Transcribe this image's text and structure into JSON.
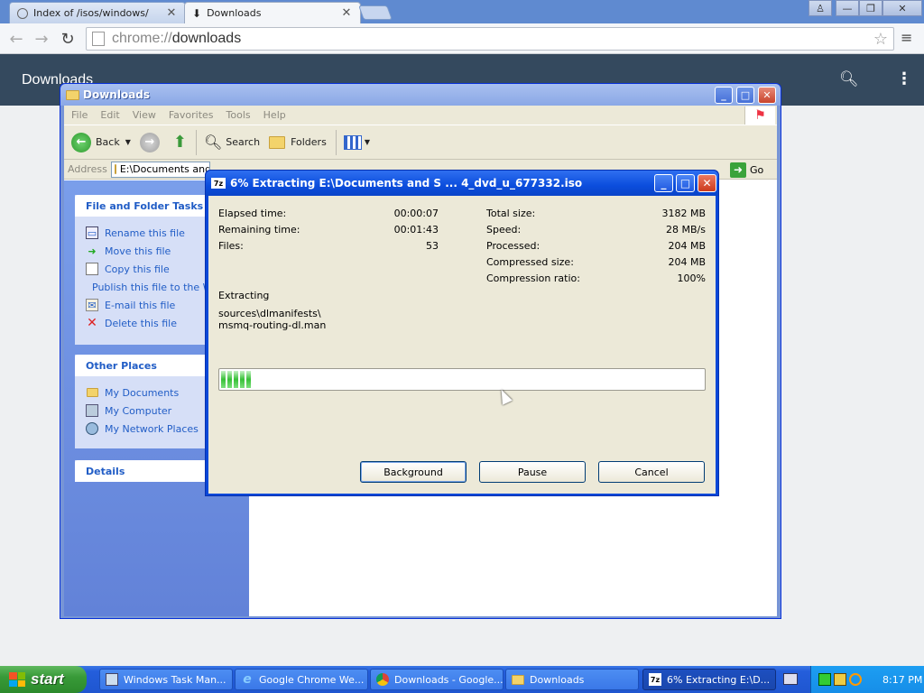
{
  "browser": {
    "tabs": [
      {
        "title": "Index of /isos/windows/",
        "active": false
      },
      {
        "title": "Downloads",
        "active": true
      }
    ],
    "url_scheme": "chrome://",
    "url_path": "downloads",
    "page_title": "Downloads"
  },
  "explorer": {
    "title": "Downloads",
    "menu": [
      "File",
      "Edit",
      "View",
      "Favorites",
      "Tools",
      "Help"
    ],
    "toolbar": {
      "back": "Back",
      "search": "Search",
      "folders": "Folders"
    },
    "address_label": "Address",
    "address_value": "E:\\Documents and Settings",
    "go_label": "Go",
    "file_folder_tasks": {
      "title": "File and Folder Tasks",
      "items": [
        "Rename this file",
        "Move this file",
        "Copy this file",
        "Publish this file to the Web",
        "E-mail this file",
        "Delete this file"
      ]
    },
    "other_places": {
      "title": "Other Places",
      "items": [
        "My Documents",
        "My Computer",
        "My Network Places"
      ]
    },
    "details": {
      "title": "Details"
    }
  },
  "zip_dialog": {
    "title": "6% Extracting E:\\Documents and S ... 4_dvd_u_677332.iso",
    "left_stats": [
      {
        "label": "Elapsed time:",
        "value": "00:00:07"
      },
      {
        "label": "Remaining time:",
        "value": "00:01:43"
      },
      {
        "label": "Files:",
        "value": "53"
      }
    ],
    "right_stats": [
      {
        "label": "Total size:",
        "value": "3182 MB"
      },
      {
        "label": "Speed:",
        "value": "28 MB/s"
      },
      {
        "label": "Processed:",
        "value": "204 MB"
      },
      {
        "label": "Compressed size:",
        "value": "204 MB"
      },
      {
        "label": "Compression ratio:",
        "value": "100%"
      }
    ],
    "status": "Extracting",
    "current_path": "sources\\dlmanifests\\",
    "current_file": "msmq-routing-dl.man",
    "progress_percent": 6,
    "buttons": {
      "background": "Background",
      "pause": "Pause",
      "cancel": "Cancel"
    }
  },
  "taskbar": {
    "start_label": "start",
    "items": [
      {
        "label": "Windows Task Man...",
        "icon": "task-manager-icon",
        "active": false
      },
      {
        "label": "Google Chrome We...",
        "icon": "ie-icon",
        "active": false
      },
      {
        "label": "Downloads - Google...",
        "icon": "chrome-icon",
        "active": false
      },
      {
        "label": "Downloads",
        "icon": "folder-icon",
        "active": false
      },
      {
        "label": "6% Extracting E:\\D...",
        "icon": "7zip-icon",
        "active": true
      }
    ],
    "clock": "8:17 PM"
  },
  "colors": {
    "xp_blue": "#0a48d8",
    "taskbar_blue": "#245edb",
    "start_green": "#389a38",
    "downloads_header": "#34495e",
    "progress_green": "#37c037"
  }
}
